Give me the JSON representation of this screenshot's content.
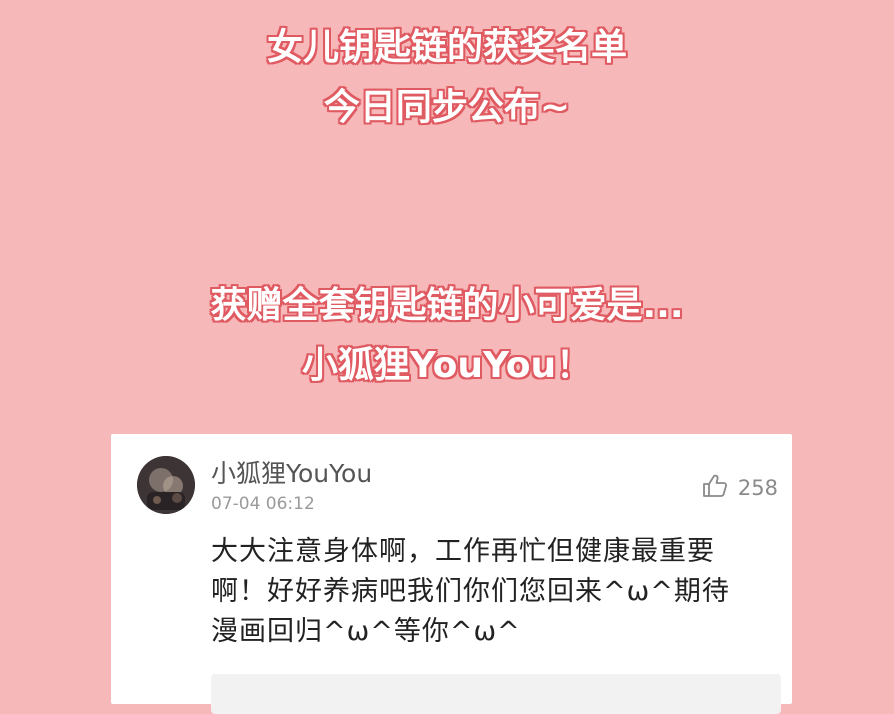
{
  "banner": {
    "line2": "女儿钥匙链的获奖名单",
    "line3": "今日同步公布~",
    "winner_intro": "获赠全套钥匙链的小可爱是...",
    "winner_name": "小狐狸YouYou！"
  },
  "comment": {
    "username": "小狐狸YouYou",
    "timestamp": "07-04 06:12",
    "likes": "258",
    "body_lines": [
      "大大注意身体啊，工作再忙但健康最重要",
      "啊！好好养病吧我们你们您回来^ω^期待",
      "漫画回归^ω^等你^ω^"
    ]
  },
  "colors": {
    "background": "#f6b8b9",
    "headline_fill": "#ffffff",
    "headline_outline": "#e05a62",
    "card": "#ffffff"
  },
  "icons": {
    "like": "thumbs-up-icon",
    "avatar": "user-avatar"
  }
}
